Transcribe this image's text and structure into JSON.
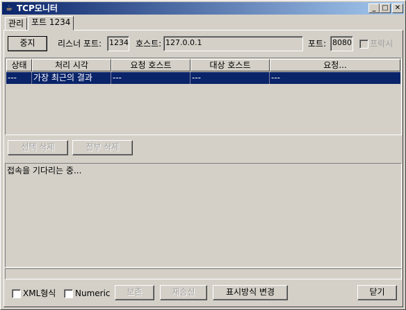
{
  "window": {
    "title": "TCP모니터",
    "min": "_",
    "max": "□",
    "close": "✕"
  },
  "tabs": [
    {
      "label": "관리"
    },
    {
      "label": "포트 1234"
    }
  ],
  "toolbar": {
    "stop_label": "중지",
    "listen_port_label": "리스너 포트:",
    "listen_port_value": "1234",
    "host_label": "호스트:",
    "host_value": "127.0.0.1",
    "port_label": "포트:",
    "port_value": "8080",
    "proxy_label": "프락시"
  },
  "table": {
    "columns": [
      "상태",
      "처리 시각",
      "요청 호스트",
      "대상 호스트",
      "요청..."
    ],
    "rows": [
      [
        "---",
        "가장 최근의 결과",
        "---",
        "---",
        "---"
      ]
    ]
  },
  "actions": {
    "remove_selected": "선택 삭제",
    "remove_all": "전부 삭제"
  },
  "status": {
    "text": "접속을 기다리는 중..."
  },
  "bottom": {
    "xml_format": "XML형식",
    "numeric": "Numeric",
    "save": "보존",
    "resend": "재송신",
    "switch_layout": "표시방식 변경",
    "close": "닫기"
  }
}
